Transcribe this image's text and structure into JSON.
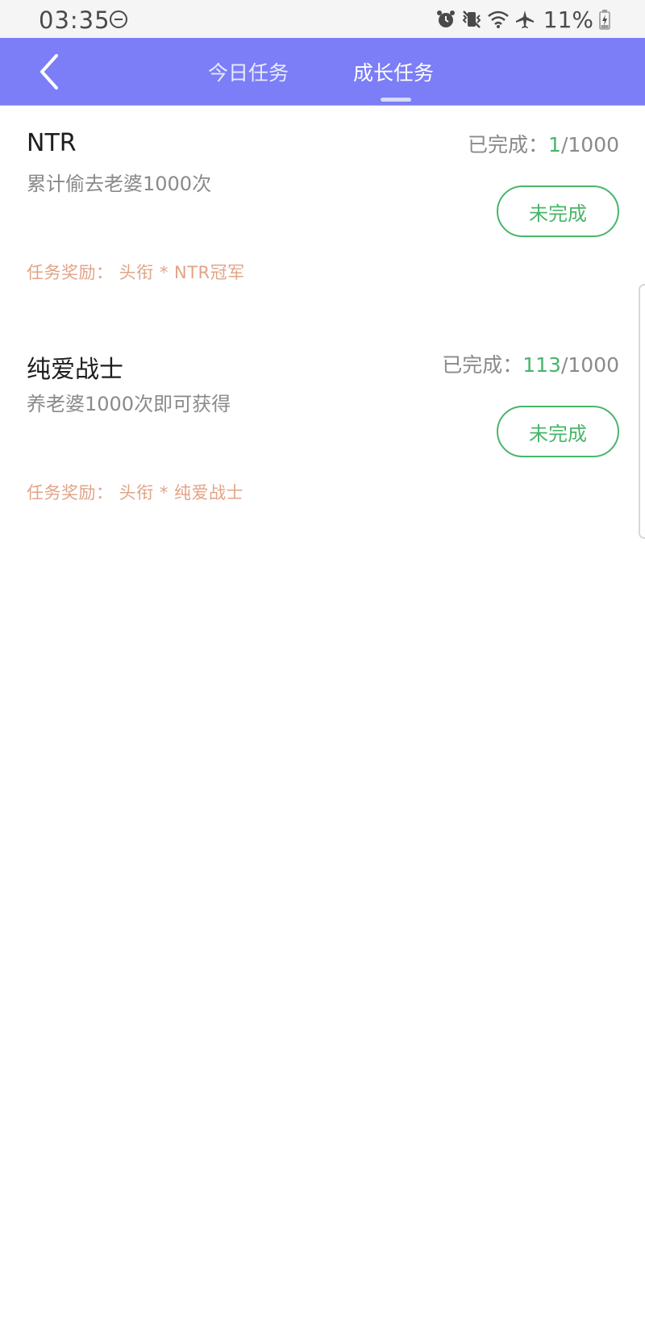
{
  "status_bar": {
    "time": "03:35",
    "battery": "11%",
    "icons": [
      "do-not-disturb-icon",
      "alarm-icon",
      "vibrate-mute-icon",
      "wifi-icon",
      "airplane-icon",
      "battery-charging-icon"
    ]
  },
  "header": {
    "back_icon": "chevron-left-icon",
    "tabs": [
      {
        "label": "今日任务",
        "active": false
      },
      {
        "label": "成长任务",
        "active": true
      }
    ],
    "color": "#7b7ef6"
  },
  "tasks": [
    {
      "title": "NTR",
      "description": "累计偷去老婆1000次",
      "progress_label": "已完成：",
      "progress_done": "1",
      "progress_total": "/1000",
      "status": "未完成",
      "reward": "任务奖励： 头衔 * NTR冠军"
    },
    {
      "title": "纯爱战士",
      "description": "养老婆1000次即可获得",
      "progress_label": "已完成：",
      "progress_done": "113",
      "progress_total": "/1000",
      "status": "未完成",
      "reward": "任务奖励： 头衔 * 纯爱战士"
    }
  ],
  "colors": {
    "accent_green": "#49b56a",
    "reward_text": "#e1a488"
  }
}
